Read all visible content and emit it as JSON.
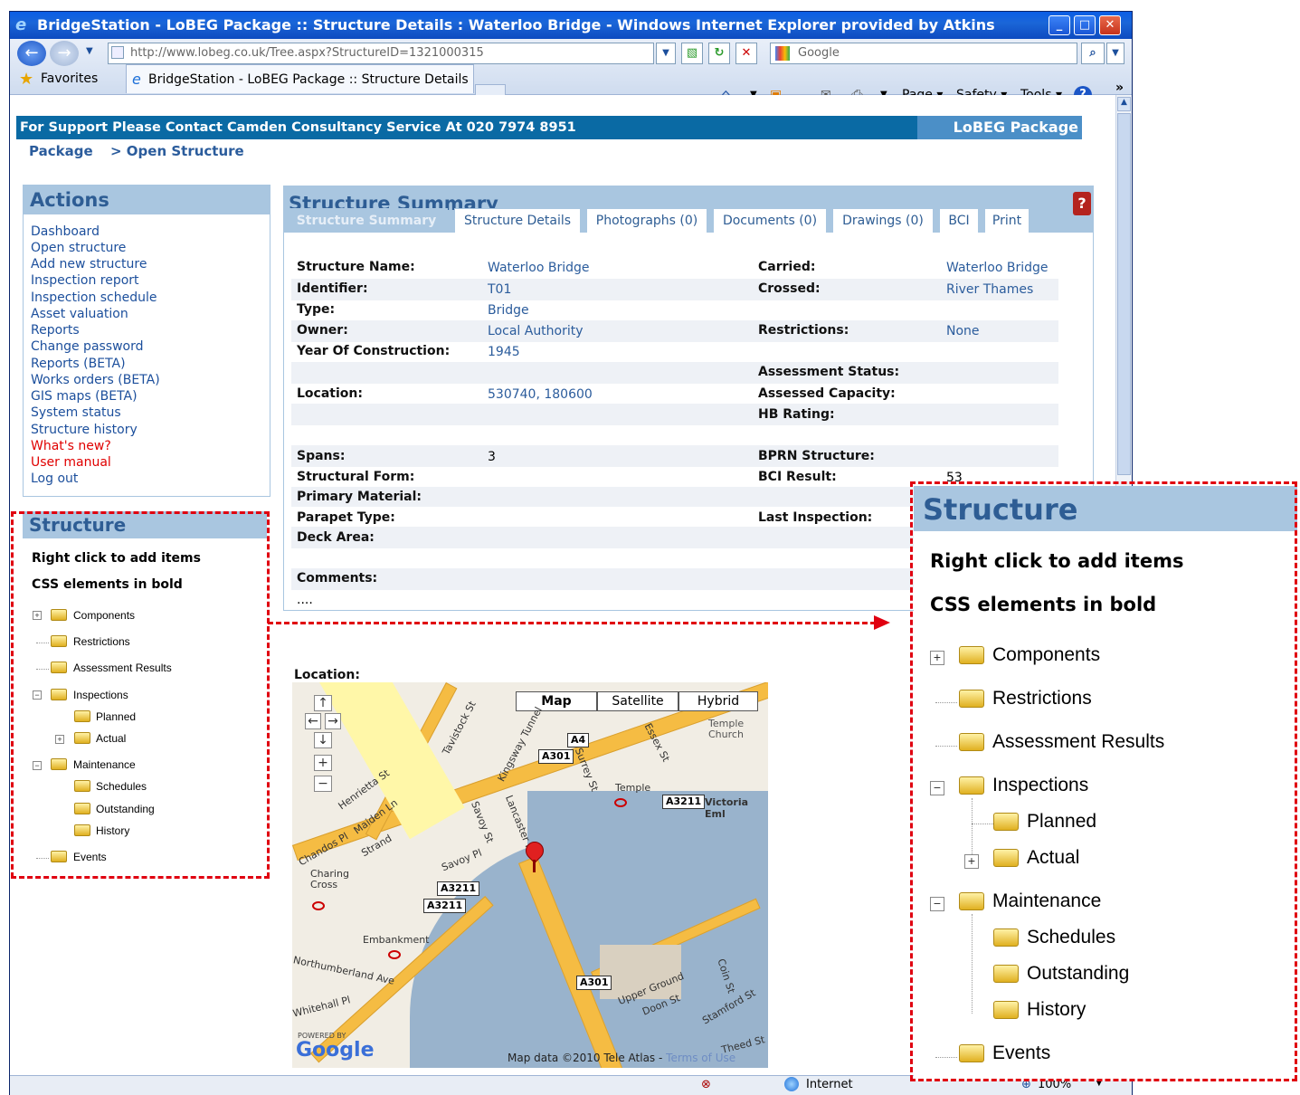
{
  "window": {
    "title": "BridgeStation - LoBEG Package :: Structure Details : Waterloo Bridge - Windows Internet Explorer provided by Atkins"
  },
  "browser": {
    "address": "http://www.lobeg.co.uk/Tree.aspx?StructureID=1321000315",
    "search_placeholder": "Google",
    "favorites_label": "Favorites",
    "tab_title": "BridgeStation - LoBEG Package :: Structure Details : ...",
    "toolbar": {
      "page": "Page",
      "safety": "Safety",
      "tools": "Tools"
    },
    "status": {
      "zone": "Internet",
      "zoom": "100%"
    }
  },
  "header": {
    "support_text": "For Support Please Contact Camden Consultancy Service At 020 7974 8951",
    "brand": "LoBEG Package",
    "breadcrumb": [
      "Package",
      "> Open Structure"
    ]
  },
  "actions": {
    "title": "Actions",
    "items": [
      {
        "label": "Dashboard"
      },
      {
        "label": "Open structure"
      },
      {
        "label": "Add new structure"
      },
      {
        "label": "Inspection report"
      },
      {
        "label": "Inspection schedule"
      },
      {
        "label": "Asset valuation"
      },
      {
        "label": "Reports"
      },
      {
        "label": "Change password"
      },
      {
        "label": "Reports (BETA)"
      },
      {
        "label": "Works orders (BETA)"
      },
      {
        "label": "GIS maps (BETA)"
      },
      {
        "label": "System status"
      },
      {
        "label": "Structure history"
      },
      {
        "label": "What's new?"
      },
      {
        "label": "User manual"
      },
      {
        "label": "Log out"
      }
    ]
  },
  "structure_panel": {
    "title": "Structure",
    "hint1": "Right click to add items",
    "hint2": "CSS elements in bold",
    "tree": [
      "Components",
      "Restrictions",
      "Assessment Results",
      "Inspections",
      "Planned",
      "Actual",
      "Maintenance",
      "Schedules",
      "Outstanding",
      "History",
      "Events"
    ]
  },
  "summary": {
    "title": "Structure Summary",
    "help_icon": "?",
    "tabs": [
      "Structure Summary",
      "Structure Details",
      "Photographs (0)",
      "Documents (0)",
      "Drawings (0)",
      "BCI",
      "Print"
    ],
    "fields": {
      "structure_name": {
        "label": "Structure Name:",
        "value": "Waterloo Bridge"
      },
      "identifier": {
        "label": "Identifier:",
        "value": "T01"
      },
      "type": {
        "label": "Type:",
        "value": "Bridge"
      },
      "owner": {
        "label": "Owner:",
        "value": "Local Authority"
      },
      "year": {
        "label": "Year Of Construction:",
        "value": "1945"
      },
      "location": {
        "label": "Location:",
        "value": "530740, 180600"
      },
      "spans": {
        "label": "Spans:",
        "value": "3"
      },
      "structural_form": {
        "label": "Structural Form:"
      },
      "primary_material": {
        "label": "Primary Material:"
      },
      "parapet_type": {
        "label": "Parapet Type:"
      },
      "deck_area": {
        "label": "Deck Area:"
      },
      "comments": {
        "label": "Comments:",
        "value": "...."
      },
      "carried": {
        "label": "Carried:",
        "value": "Waterloo Bridge"
      },
      "crossed": {
        "label": "Crossed:",
        "value": "River Thames"
      },
      "restrictions": {
        "label": "Restrictions:",
        "value": "None"
      },
      "assessment_status": {
        "label": "Assessment Status:"
      },
      "assessed_capacity": {
        "label": "Assessed Capacity:"
      },
      "hb_rating": {
        "label": "HB Rating:"
      },
      "bprn_structure": {
        "label": "BPRN Structure:"
      },
      "bci_result": {
        "label": "BCI Result:",
        "value": "53"
      },
      "last_inspection": {
        "label": "Last Inspection:"
      }
    },
    "location_heading": "Location:"
  },
  "map": {
    "buttons": [
      "Map",
      "Satellite",
      "Hybrid"
    ],
    "labels": [
      "Strand",
      "Temple",
      "Victoria Eml",
      "Embankment",
      "Savoy Pl",
      "Chandos Pl",
      "Charing Cross",
      "Temple Church",
      "Kingsway Tunnel",
      "Lancaster Pl",
      "Savoy St",
      "Surrey St",
      "Essex St",
      "Tavistock St",
      "Henrietta St",
      "Maiden Ln",
      "Northumberland Ave",
      "Whitehall Pl",
      "Upper Ground",
      "Doon St",
      "Stamford St",
      "Coin St",
      "Theed St"
    ],
    "roads": [
      "A4",
      "A301",
      "A3211",
      "A3211",
      "A3211",
      "A301"
    ],
    "attribution": "Map data ©2010 Tele Atlas -",
    "terms": "Terms of Use",
    "powered": "POWERED BY",
    "logo": "Google"
  }
}
